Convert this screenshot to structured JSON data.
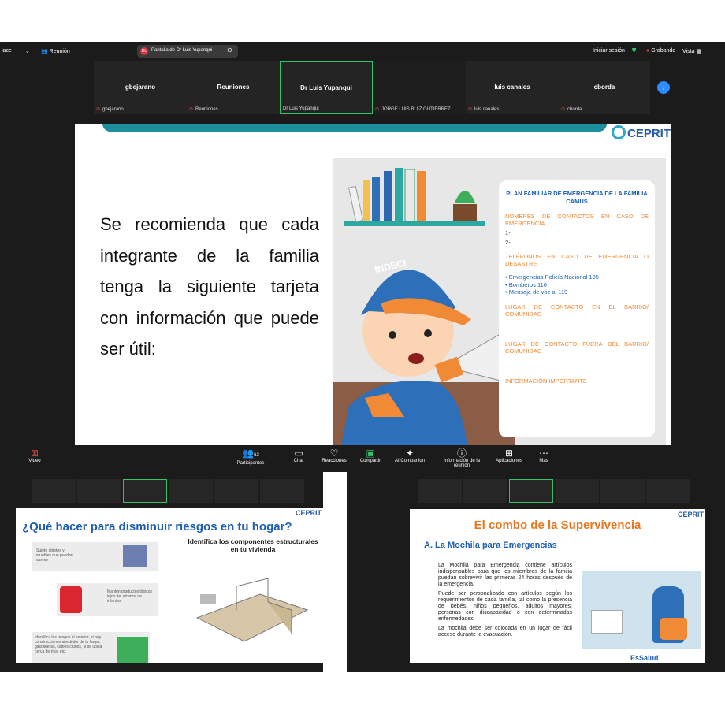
{
  "main": {
    "topbar": {
      "app_left": "lace",
      "meeting_label": "Reunión",
      "share_badge": "DL",
      "share_title": "Pantalla de Dr Luis Yupanqui",
      "signin": "Iniciar sesión",
      "recording": "Grabando",
      "view": "Vista"
    },
    "participants": [
      {
        "name": "gbejarano",
        "sub": "gbejarano"
      },
      {
        "name": "Reuniones",
        "sub": "Reuniones"
      },
      {
        "name": "Dr Luis Yupanqui",
        "sub": "Dr Luis Yupanqui",
        "active": true
      },
      {
        "name": "",
        "sub": "JORGE LUIS RUIZ GUTIÉRREZ"
      },
      {
        "name": "luis canales",
        "sub": "luis canales"
      },
      {
        "name": "cborda",
        "sub": "cborda"
      }
    ],
    "slide": {
      "logo": "CEPRIT",
      "text": "Se recomienda que cada integrante de la familia tenga la siguiente tarjeta con información que puede ser útil:",
      "cap_badge": "INDECI",
      "card": {
        "title": "PLAN FAMILIAR DE EMERGENCIA DE LA FAMILIA CAMUS",
        "s1": "NOMBRES DE CONTACTOS EN CASO DE EMERGENCIA",
        "l1": "1-",
        "l2": "2-",
        "s2": "TELÉFONOS EN CASO DE EMERGENCIA O DESASTRE",
        "b1": "• Emergencias Policía Nacional 105",
        "b2": "• Bomberos 116",
        "b3": "• Mensaje de voz al 119",
        "s3": "LUGAR DE CONTACTO EN EL BARRIO/ COMUNIDAD",
        "s4": "LUGAR DE CONTACTO FUERA DEL BARRIO/ COMUNIDAD",
        "s5": "INFORMACIÓN IMPORTANTE"
      }
    },
    "toolbar": {
      "video": "Video",
      "participants_count": "62",
      "participants": "Participantes",
      "chat": "Chat",
      "reactions": "Reacciones",
      "share": "Compartir",
      "ai": "AI Companion",
      "info": "Información de la reunión",
      "apps": "Aplicaciones",
      "more": "Más"
    }
  },
  "thumb_left": {
    "title": "¿Qué hacer para disminuir riesgos en tu hogar?",
    "logo": "CEPRIT",
    "p1": "Sujete objetos y muebles que puedan caerse",
    "p2": "Mantén productos tóxicos lejos del alcance de infantes",
    "p3": "Identifica los riesgos al exterior, si hay construcciones alrededor de tu hogar, gasolineras, cables caídos, si se ubica cerca de ríos, etc.",
    "heading": "Identifica los componentes estructurales en tu vivienda"
  },
  "thumb_right": {
    "title": "El combo de la Supervivencia",
    "logo": "CEPRIT",
    "subtitle": "A. La Mochila para Emergencias",
    "p1": "La Mochila para Emergencia contiene artículos indispensables para que los miembros de la familia puedan sobrevivir las primeras 24 horas después de la emergencia.",
    "p2": "Puede ser personalizado con artículos según los requerimientos de cada familia, tal como la presencia de bebés, niños pequeños, adultos mayores, personas con discapacidad o con determinadas enfermedades.",
    "p3": "La mochila debe ser colocada en un lugar de fácil acceso durante la evacuación.",
    "footer_logo": "EsSalud"
  }
}
